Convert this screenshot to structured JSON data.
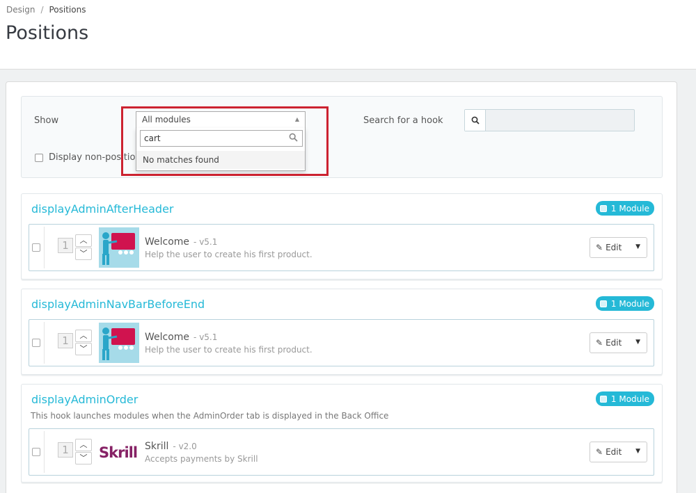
{
  "breadcrumb": {
    "parent": "Design",
    "separator": "/",
    "current": "Positions"
  },
  "page_title": "Positions",
  "filter": {
    "show_label": "Show",
    "select_value": "All modules",
    "select_search": "cart",
    "no_matches": "No matches found",
    "display_nonpositionable": "Display non-positionable hooks",
    "search_hook_label": "Search for a hook",
    "search_hook_value": ""
  },
  "colors": {
    "accent": "#25b9d7",
    "highlight": "#cc2230",
    "skrill": "#862165",
    "welcome_pink": "#d0134f"
  },
  "hooks": [
    {
      "name": "displayAdminAfterHeader",
      "description": "",
      "badge": "1 Module",
      "module": {
        "position": "1",
        "name": "Welcome",
        "version": "- v5.1",
        "description": "Help the user to create his first product.",
        "logo": "welcome",
        "edit": "Edit"
      }
    },
    {
      "name": "displayAdminNavBarBeforeEnd",
      "description": "",
      "badge": "1 Module",
      "module": {
        "position": "1",
        "name": "Welcome",
        "version": "- v5.1",
        "description": "Help the user to create his first product.",
        "logo": "welcome",
        "edit": "Edit"
      }
    },
    {
      "name": "displayAdminOrder",
      "description": "This hook launches modules when the AdminOrder tab is displayed in the Back Office",
      "badge": "1 Module",
      "module": {
        "position": "1",
        "name": "Skrill",
        "version": "- v2.0",
        "description": "Accepts payments by Skrill",
        "logo": "Skrill",
        "edit": "Edit"
      }
    }
  ]
}
